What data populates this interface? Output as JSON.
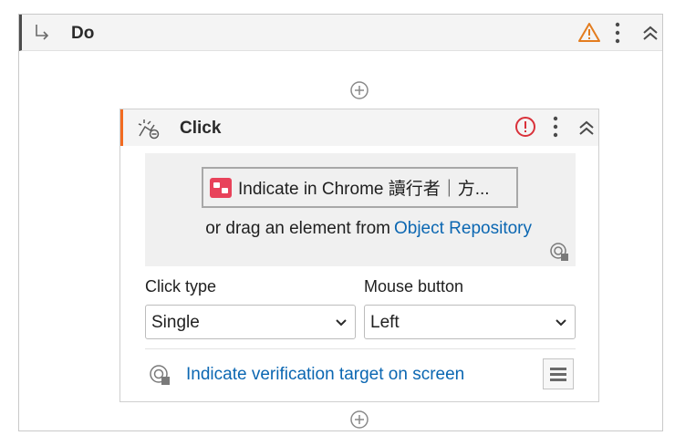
{
  "do_block": {
    "title": "Do",
    "icons": {
      "arrow": "arrow-return-icon",
      "warning": "warning-triangle-icon",
      "more": "more-vertical-icon",
      "collapse": "chevron-double-up-icon"
    },
    "colors": {
      "warning": "#e37c1e",
      "accent_bar": "#4b4b4b"
    }
  },
  "add_buttons": {
    "icon": "add-circle-icon"
  },
  "click_activity": {
    "title": "Click",
    "icons": {
      "activity": "click-activity-icon",
      "error": "error-circle-icon",
      "more": "more-vertical-icon",
      "collapse": "chevron-double-up-icon"
    },
    "colors": {
      "error": "#d9313a",
      "accent_bar": "#f26b21",
      "link": "#0b67b2"
    },
    "target": {
      "indicate_button_label": "Indicate in Chrome 讀行者｜方...",
      "indicate_icon": "chrome-target-badge-icon",
      "drag_text": "or drag an element from",
      "repository_link": "Object Repository",
      "settings_icon": "target-settings-icon"
    },
    "click_type": {
      "label": "Click type",
      "value": "Single"
    },
    "mouse_button": {
      "label": "Mouse button",
      "value": "Left"
    },
    "verification": {
      "link": "Indicate verification target on screen",
      "icon": "verification-target-icon",
      "menu_icon": "hamburger-menu-icon"
    }
  }
}
